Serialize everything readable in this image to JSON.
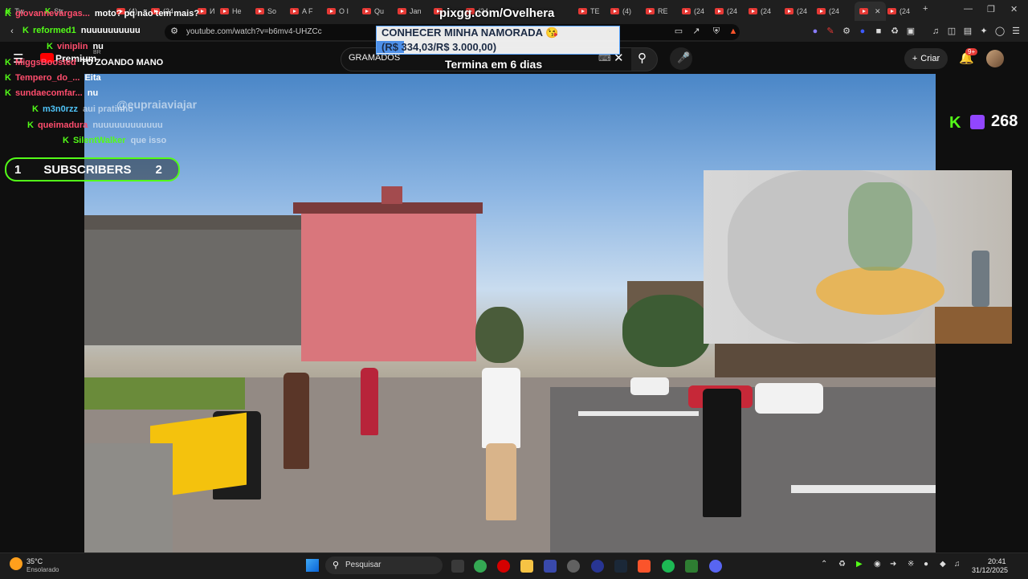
{
  "browser": {
    "tabs": [
      {
        "label": "Tw"
      },
      {
        "label": "Str"
      },
      {
        "label": "(4)"
      },
      {
        "label": "(24"
      },
      {
        "label": "И"
      },
      {
        "label": "He"
      },
      {
        "label": "So"
      },
      {
        "label": "A F"
      },
      {
        "label": "O I"
      },
      {
        "label": "Qu"
      },
      {
        "label": "Jan"
      },
      {
        "label": ""
      },
      {
        "label": "(24"
      },
      {
        "label": "TE"
      },
      {
        "label": "(4)"
      },
      {
        "label": "RE"
      },
      {
        "label": "(24"
      },
      {
        "label": "(24"
      },
      {
        "label": "(24"
      },
      {
        "label": "(24"
      },
      {
        "label": "(24"
      },
      {
        "label": ""
      },
      {
        "label": "(24"
      }
    ],
    "new_tab": "+",
    "url": "youtube.com/watch?v=b6mv4-UHZCc"
  },
  "youtube": {
    "premium_label": "Premium",
    "premium_region": "BR",
    "search_value": "GRAMADOS",
    "create_label": "Criar",
    "notif_count": "9+"
  },
  "stream_overlay": {
    "donation_link": "pixgg.com/Ovelhera",
    "goal_title": "CONHECER MINHA NAMORADA 😘",
    "goal_amount": "(R$ 334,03/R$ 3.000,00)",
    "goal_progress": 0.111,
    "goal_ends": "Termina em 6 dias",
    "viewer_count": "268",
    "subs_left": "1",
    "subs_label": "SUBSCRIBERS",
    "subs_right": "2",
    "video_watermark": "@eupraiaviajar"
  },
  "chat": [
    {
      "user": "giovannevargas...",
      "msg": "moto? pq não tem mais?",
      "user_color": "#ff4d6d"
    },
    {
      "user": "reformed1",
      "msg": "nuuuuuuuuuu",
      "user_color": "#53fc18"
    },
    {
      "user": "viniplin",
      "msg": "nu",
      "user_color": "#ff4d6d"
    },
    {
      "user": "MiggsBoosted",
      "msg": "TO ZOANDO MANO",
      "user_color": "#ff4d6d"
    },
    {
      "user": "Tempero_do_...",
      "msg": "Eita",
      "user_color": "#ff4d6d"
    },
    {
      "user": "sundaecomfar...",
      "msg": "nu",
      "user_color": "#ff4d6d"
    },
    {
      "user": "m3n0rzz",
      "msg": "aui pratinho",
      "user_color": "#4fc3f7"
    },
    {
      "user": "queimadura",
      "msg": "nuuuuuuuuuuuu",
      "user_color": "#ff4d6d"
    },
    {
      "user": "SilentWalker",
      "msg": "que isso",
      "user_color": "#53fc18"
    }
  ],
  "taskbar": {
    "weather_temp": "35°C",
    "weather_desc": "Ensolarado",
    "search_placeholder": "Pesquisar",
    "time": "20:41",
    "date": "31/12/2025"
  }
}
